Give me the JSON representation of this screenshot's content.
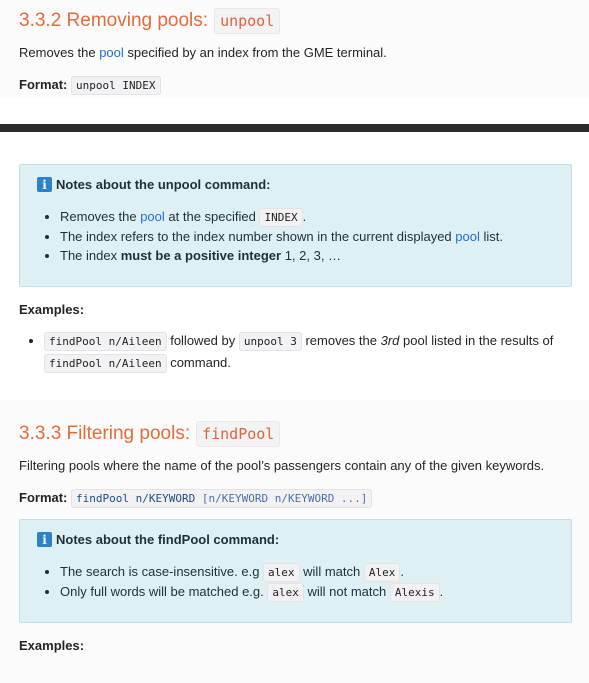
{
  "s332": {
    "title": "3.3.2 Removing pools:",
    "code": "unpool",
    "desc_prefix": "Removes the ",
    "desc_link": "pool",
    "desc_suffix": " specified by an index from the GME terminal.",
    "format_label": "Format:",
    "format_code": "unpool INDEX"
  },
  "note1": {
    "title": "Notes about the unpool command:",
    "b1_pre": "Removes the ",
    "b1_link": "pool",
    "b1_mid": " at the specified ",
    "b1_code": "INDEX",
    "b1_end": ".",
    "b2_pre": "The index refers to the index number shown in the current displayed ",
    "b2_link": "pool",
    "b2_end": " list.",
    "b3_pre": "The index ",
    "b3_bold": "must be a positive integer",
    "b3_end": " 1, 2, 3, …"
  },
  "ex1": {
    "label": "Examples:",
    "code1": "findPool n/Aileen",
    "t1": " followed by ",
    "code2": "unpool 3",
    "t2": " removes the ",
    "em": "3rd",
    "t3": " pool listed in the results of ",
    "code3": "findPool n/Aileen",
    "t4": " command."
  },
  "s333": {
    "title": "3.3.3 Filtering pools:",
    "code": "findPool",
    "desc": "Filtering pools where the name of the pool’s passengers contain any of the given keywords.",
    "format_label": "Format:",
    "format_a": "findPool n/KEYWORD ",
    "format_b": "[n/KEYWORD n/KEYWORD ...]"
  },
  "note2": {
    "title": "Notes about the findPool command:",
    "b1_pre": "The search is case-insensitive. e.g ",
    "b1_code1": "alex",
    "b1_mid": " will match ",
    "b1_code2": "Alex",
    "b1_end": ".",
    "b2_pre": "Only full words will be matched e.g. ",
    "b2_code1": "alex",
    "b2_mid": " will not match ",
    "b2_code2": "Alexis",
    "b2_end": "."
  },
  "ex2": {
    "label": "Examples:"
  },
  "icons": {
    "info": "info-icon"
  }
}
